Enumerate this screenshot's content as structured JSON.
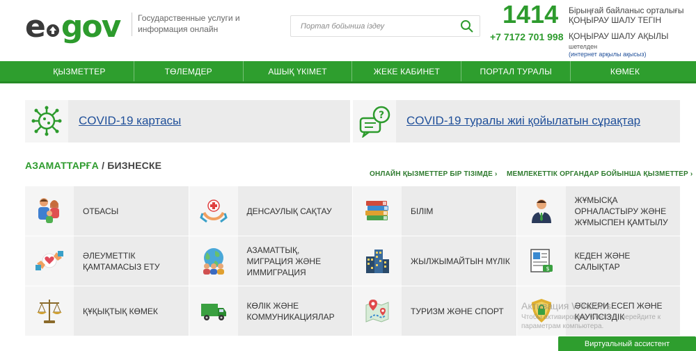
{
  "header": {
    "logo_e": "e",
    "logo_gov": "gov",
    "tagline": "Государственные услуги и информация онлайн",
    "search_placeholder": "Портал бойынша іздеу",
    "call_short": "1414",
    "call_free_1": "Бірыңғай байланыс орталығы",
    "call_free_2": "ҚОҢЫРАУ ШАЛУ ТЕГІН",
    "call_phone": "+7 7172 701 998",
    "call_paid": "ҚОҢЫРАУ ШАЛУ АҚЫЛЫ",
    "call_abroad": "шетелден",
    "call_abroad_note": "(интернет арқылы ақысыз)"
  },
  "nav": [
    "ҚЫЗМЕТТЕР",
    "ТӨЛЕМДЕР",
    "АШЫҚ ҮКІМЕТ",
    "ЖЕКЕ КАБИНЕТ",
    "ПОРТАЛ ТУРАЛЫ",
    "КӨМЕК"
  ],
  "banners": {
    "map_label": "COVID-19 картасы",
    "faq_label": "COVID-19 туралы жиі қойылатын сұрақтар"
  },
  "section": {
    "title_citizens": "АЗАМАТТАРҒА",
    "title_sep": " / ",
    "title_business": "БИЗНЕСКЕ",
    "link_all": "ОНЛАЙН ҚЫЗМЕТТЕР БІР ТІЗІМДЕ ›",
    "link_gov": "МЕМЛЕКЕТТІК ОРГАНДАР БОЙЫНША ҚЫЗМЕТТЕР ›"
  },
  "categories": [
    {
      "label": "Отбасы",
      "icon": "family-icon"
    },
    {
      "label": "Денсаулық сақтау",
      "icon": "health-icon"
    },
    {
      "label": "Білім",
      "icon": "books-icon"
    },
    {
      "label": "Жұмысқа орналастыру және жұмыспен қамтылу",
      "icon": "employee-icon"
    },
    {
      "label": "Әлеуметтік қамтамасыз ету",
      "icon": "social-icon"
    },
    {
      "label": "Азаматтық, миграция және иммиграция",
      "icon": "globe-people-icon"
    },
    {
      "label": "Жылжымайтын мүлік",
      "icon": "buildings-icon"
    },
    {
      "label": "Кеден және салықтар",
      "icon": "customs-icon"
    },
    {
      "label": "Құқықтық көмек",
      "icon": "scales-icon"
    },
    {
      "label": "Көлік және коммуникациялар",
      "icon": "truck-icon"
    },
    {
      "label": "Туризм және спорт",
      "icon": "map-pin-icon"
    },
    {
      "label": "Әскери есеп және қауіпсіздік",
      "icon": "shield-icon"
    }
  ],
  "watermark": {
    "title": "Активация Windows",
    "text": "Чтобы активировать Windows, перейдите к параметрам компьютера."
  },
  "assistant_label": "Виртуальный ассистент",
  "colors": {
    "brand_green": "#2e9e2e",
    "link_blue": "#1f4f99"
  }
}
